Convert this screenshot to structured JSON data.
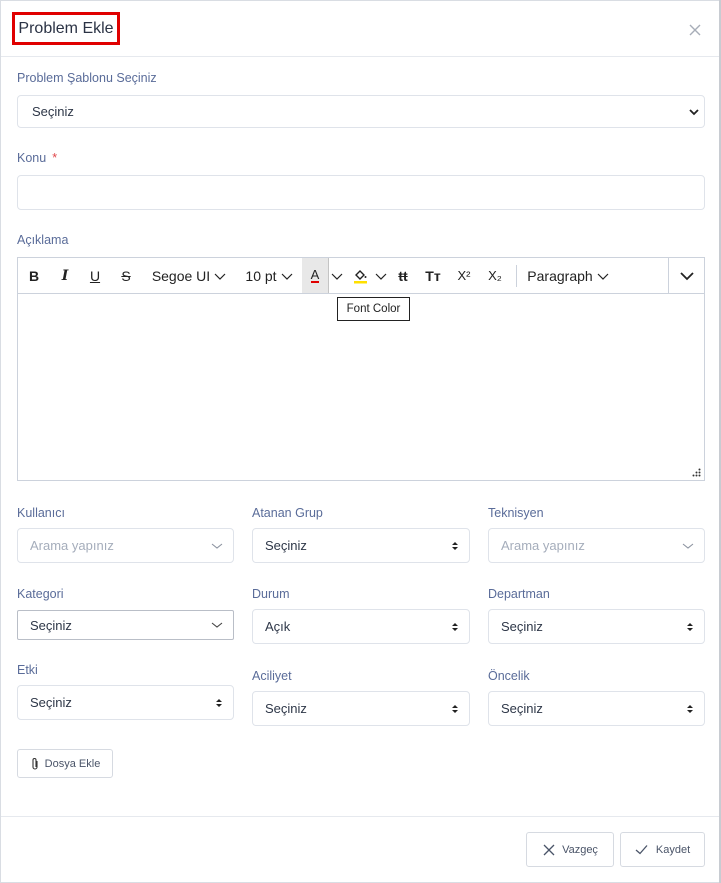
{
  "modal": {
    "title": "Problem Ekle",
    "close_icon": "close-icon"
  },
  "template": {
    "label": "Problem Şablonu Seçiniz",
    "value": "Seçiniz"
  },
  "subject": {
    "label": "Konu",
    "required_mark": "*",
    "value": ""
  },
  "description": {
    "label": "Açıklama",
    "toolbar": {
      "bold": "B",
      "italic": "I",
      "underline": "U",
      "strikethrough": "S",
      "font_family": "Segoe UI",
      "font_size": "10 pt",
      "font_color_glyph": "A",
      "font_color_hex": "#e00000",
      "highlight_hex": "#ffe000",
      "clear_format": "tt",
      "case": "Tт",
      "superscript": "X²",
      "subscript": "X₂",
      "format": "Paragraph"
    },
    "tooltip": "Font Color"
  },
  "fields": {
    "user": {
      "label": "Kullanıcı",
      "placeholder": "Arama yapınız"
    },
    "assigned_group": {
      "label": "Atanan Grup",
      "value": "Seçiniz"
    },
    "technician": {
      "label": "Teknisyen",
      "placeholder": "Arama yapınız"
    },
    "category": {
      "label": "Kategori",
      "value": "Seçiniz"
    },
    "status": {
      "label": "Durum",
      "value": "Açık"
    },
    "department": {
      "label": "Departman",
      "value": "Seçiniz"
    },
    "impact": {
      "label": "Etki",
      "value": "Seçiniz"
    },
    "urgency": {
      "label": "Aciliyet",
      "value": "Seçiniz"
    },
    "priority": {
      "label": "Öncelik",
      "value": "Seçiniz"
    }
  },
  "attach": {
    "label": "Dosya Ekle"
  },
  "footer": {
    "cancel": "Vazgeç",
    "save": "Kaydet"
  }
}
